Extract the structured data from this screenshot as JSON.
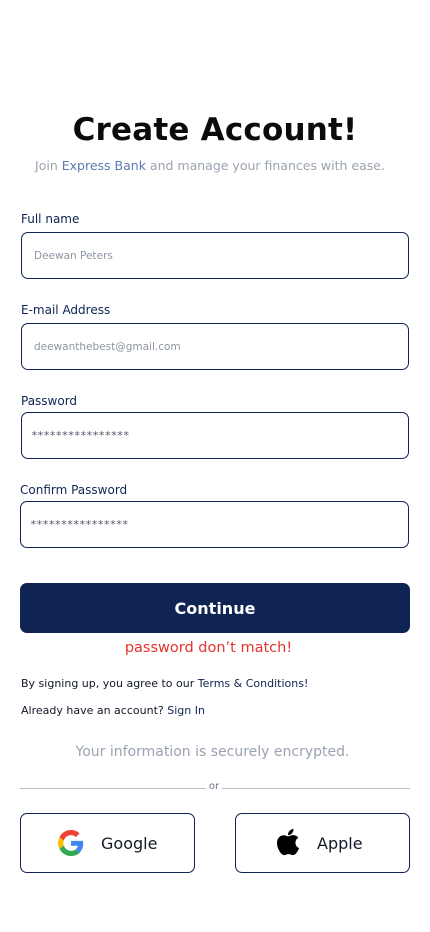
{
  "header": {
    "title": "Create Account!",
    "subtitle_pre": "Join ",
    "subtitle_brand": "Express Bank",
    "subtitle_post": " and manage your finances with ease."
  },
  "form": {
    "full_name": {
      "label": "Full name",
      "value": "Deewan Peters"
    },
    "email": {
      "label": "E-mail Address",
      "value": "deewanthebest@gmail.com"
    },
    "password": {
      "label": "Password",
      "value": "****************"
    },
    "confirm_password": {
      "label": "Confirm Password",
      "value": "****************"
    }
  },
  "continue_label": "Continue",
  "error_message": "password don’t match!",
  "terms": {
    "prefix": "By signing up, you agree to our ",
    "link": "Terms & Conditions!"
  },
  "signin": {
    "prefix": "Already have an account? ",
    "link": "Sign In"
  },
  "secure_note": "Your information is securely encrypted.",
  "divider_text": "or",
  "social": {
    "google": {
      "label": "Google",
      "icon": "google-icon"
    },
    "apple": {
      "label": "Apple",
      "icon": "apple-icon"
    }
  },
  "colors": {
    "primary": "#0f2452",
    "error": "#e5322d",
    "muted": "#9aa3b0"
  }
}
